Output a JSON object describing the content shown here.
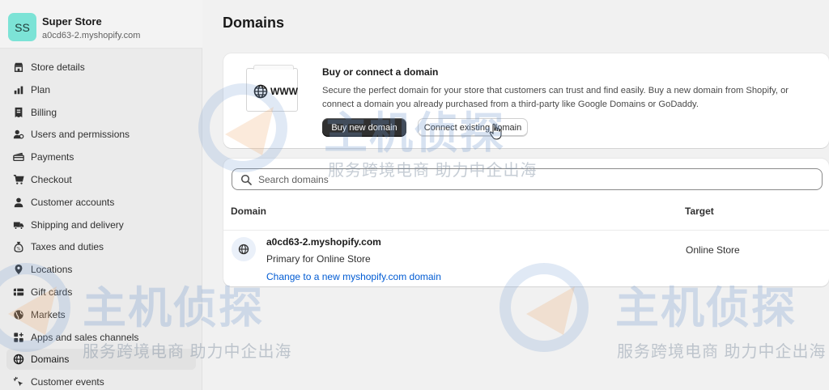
{
  "store": {
    "initials": "SS",
    "name": "Super Store",
    "url": "a0cd63-2.myshopify.com"
  },
  "sidebar": {
    "items": [
      {
        "label": "Store details",
        "icon": "store-icon"
      },
      {
        "label": "Plan",
        "icon": "plan-chart-icon"
      },
      {
        "label": "Billing",
        "icon": "billing-receipt-icon"
      },
      {
        "label": "Users and permissions",
        "icon": "users-icon"
      },
      {
        "label": "Payments",
        "icon": "payments-icon"
      },
      {
        "label": "Checkout",
        "icon": "cart-icon"
      },
      {
        "label": "Customer accounts",
        "icon": "customer-icon"
      },
      {
        "label": "Shipping and delivery",
        "icon": "truck-icon"
      },
      {
        "label": "Taxes and duties",
        "icon": "taxes-bag-icon"
      },
      {
        "label": "Locations",
        "icon": "location-pin-icon"
      },
      {
        "label": "Gift cards",
        "icon": "gift-card-icon"
      },
      {
        "label": "Markets",
        "icon": "markets-globe-icon"
      },
      {
        "label": "Apps and sales channels",
        "icon": "apps-icon"
      },
      {
        "label": "Domains",
        "icon": "domains-globe-icon",
        "active": true
      },
      {
        "label": "Customer events",
        "icon": "sparkle-cursor-icon"
      }
    ]
  },
  "page": {
    "title": "Domains"
  },
  "buy_card": {
    "illustration_text": "WWW",
    "title": "Buy or connect a domain",
    "description": "Secure the perfect domain for your store that customers can trust and find easily. Buy a new domain from Shopify, or connect a domain you already purchased from a third-party like Google Domains or GoDaddy.",
    "buy_button": "Buy new domain",
    "connect_button": "Connect existing domain"
  },
  "domains": {
    "search_placeholder": "Search domains",
    "columns": {
      "domain": "Domain",
      "target": "Target"
    },
    "rows": [
      {
        "domain": "a0cd63-2.myshopify.com",
        "subtitle": "Primary for Online Store",
        "link": "Change to a new myshopify.com domain",
        "target": "Online Store"
      }
    ]
  },
  "watermark": {
    "main": "主机侦探",
    "sub": "服务跨境电商 助力中企出海"
  },
  "colors": {
    "avatar": "#7ce3d6",
    "primary_button": "#303030",
    "link": "#005bd3"
  }
}
